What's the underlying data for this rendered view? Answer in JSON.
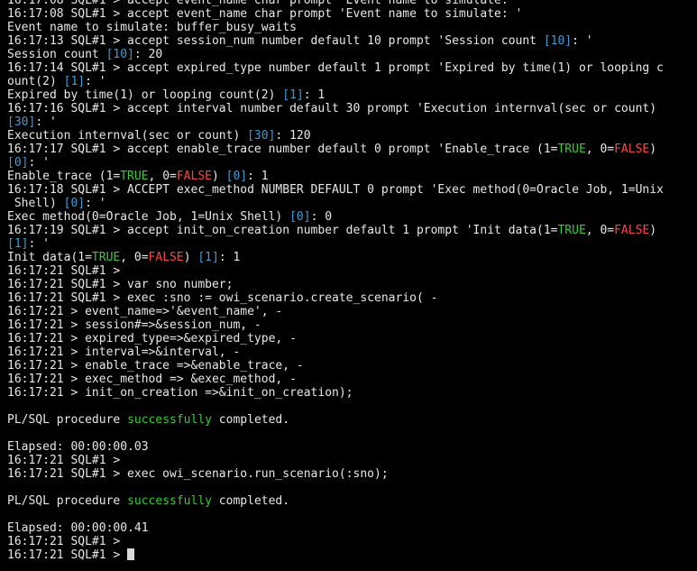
{
  "colors": {
    "background": "#000000",
    "text": "#e8e8e8",
    "true_highlight": "#33cc33",
    "false_highlight": "#ff4444",
    "default_highlight": "#3a9fd6"
  },
  "terminal": {
    "lines": [
      [
        {
          "t": "16:17:08 SQL#1 > accept event_name char prompt 'Event name to simulate: '"
        }
      ],
      [
        {
          "t": "16:17:08 SQL#1 > accept event_name char prompt 'Event name to simulate: '"
        }
      ],
      [
        {
          "t": "Event name to simulate: buffer_busy_waits"
        }
      ],
      [
        {
          "t": "16:17:13 SQL#1 > accept session_num number default 10 prompt 'Session count "
        },
        {
          "t": "[10]",
          "c": "blue"
        },
        {
          "t": ": '"
        }
      ],
      [
        {
          "t": "Session count "
        },
        {
          "t": "[10]",
          "c": "blue"
        },
        {
          "t": ": 20"
        }
      ],
      [
        {
          "t": "16:17:14 SQL#1 > accept expired_type number default 1 prompt 'Expired by time(1) or looping c"
        }
      ],
      [
        {
          "t": "ount(2) "
        },
        {
          "t": "[1]",
          "c": "blue"
        },
        {
          "t": ": '"
        }
      ],
      [
        {
          "t": "Expired by time(1) or looping count(2) "
        },
        {
          "t": "[1]",
          "c": "blue"
        },
        {
          "t": ": 1"
        }
      ],
      [
        {
          "t": "16:17:16 SQL#1 > accept interval number default 30 prompt 'Execution internval(sec or count)"
        }
      ],
      [
        {
          "t": "[30]",
          "c": "blue"
        },
        {
          "t": ": '"
        }
      ],
      [
        {
          "t": "Execution internval(sec or count) "
        },
        {
          "t": "[30]",
          "c": "blue"
        },
        {
          "t": ": 120"
        }
      ],
      [
        {
          "t": "16:17:17 SQL#1 > accept enable_trace number default 0 prompt 'Enable_trace (1="
        },
        {
          "t": "TRUE",
          "c": "green"
        },
        {
          "t": ", 0="
        },
        {
          "t": "FALSE",
          "c": "red"
        },
        {
          "t": ")"
        }
      ],
      [
        {
          "t": "[0]",
          "c": "blue"
        },
        {
          "t": ": '"
        }
      ],
      [
        {
          "t": "Enable_trace (1="
        },
        {
          "t": "TRUE",
          "c": "green"
        },
        {
          "t": ", 0="
        },
        {
          "t": "FALSE",
          "c": "red"
        },
        {
          "t": ") "
        },
        {
          "t": "[0]",
          "c": "blue"
        },
        {
          "t": ": 1"
        }
      ],
      [
        {
          "t": "16:17:18 SQL#1 > ACCEPT exec_method NUMBER DEFAULT 0 prompt 'Exec method(0=Oracle Job, 1=Unix"
        }
      ],
      [
        {
          "t": " Shell) "
        },
        {
          "t": "[0]",
          "c": "blue"
        },
        {
          "t": ": '"
        }
      ],
      [
        {
          "t": "Exec method(0=Oracle Job, 1=Unix Shell) "
        },
        {
          "t": "[0]",
          "c": "blue"
        },
        {
          "t": ": 0"
        }
      ],
      [
        {
          "t": "16:17:19 SQL#1 > accept init_on_creation number default 1 prompt 'Init data(1="
        },
        {
          "t": "TRUE",
          "c": "green"
        },
        {
          "t": ", 0="
        },
        {
          "t": "FALSE",
          "c": "red"
        },
        {
          "t": ")"
        }
      ],
      [
        {
          "t": "[1]",
          "c": "blue"
        },
        {
          "t": ": '"
        }
      ],
      [
        {
          "t": "Init data(1="
        },
        {
          "t": "TRUE",
          "c": "green"
        },
        {
          "t": ", 0="
        },
        {
          "t": "FALSE",
          "c": "red"
        },
        {
          "t": ") "
        },
        {
          "t": "[1]",
          "c": "blue"
        },
        {
          "t": ": 1"
        }
      ],
      [
        {
          "t": "16:17:21 SQL#1 >"
        }
      ],
      [
        {
          "t": "16:17:21 SQL#1 > var sno number;"
        }
      ],
      [
        {
          "t": "16:17:21 SQL#1 > exec :sno := owi_scenario.create_scenario( -"
        }
      ],
      [
        {
          "t": "16:17:21 > event_name=>'&event_name', -"
        }
      ],
      [
        {
          "t": "16:17:21 > session#=>&session_num, -"
        }
      ],
      [
        {
          "t": "16:17:21 > expired_type=>&expired_type, -"
        }
      ],
      [
        {
          "t": "16:17:21 > interval=>&interval, -"
        }
      ],
      [
        {
          "t": "16:17:21 > enable_trace =>&enable_trace, -"
        }
      ],
      [
        {
          "t": "16:17:21 > exec_method => &exec_method, -"
        }
      ],
      [
        {
          "t": "16:17:21 > init_on_creation =>&init_on_creation);"
        }
      ],
      [
        {
          "t": ""
        }
      ],
      [
        {
          "t": "PL/SQL procedure "
        },
        {
          "t": "successfully",
          "c": "green"
        },
        {
          "t": " completed."
        }
      ],
      [
        {
          "t": ""
        }
      ],
      [
        {
          "t": "Elapsed: 00:00:00.03"
        }
      ],
      [
        {
          "t": "16:17:21 SQL#1 >"
        }
      ],
      [
        {
          "t": "16:17:21 SQL#1 > exec owi_scenario.run_scenario(:sno);"
        }
      ],
      [
        {
          "t": ""
        }
      ],
      [
        {
          "t": "PL/SQL procedure "
        },
        {
          "t": "successfully",
          "c": "green"
        },
        {
          "t": " completed."
        }
      ],
      [
        {
          "t": ""
        }
      ],
      [
        {
          "t": "Elapsed: 00:00:00.41"
        }
      ],
      [
        {
          "t": "16:17:21 SQL#1 >"
        }
      ],
      [
        {
          "t": "16:17:21 SQL#1 > "
        }
      ]
    ]
  },
  "status_bar": {
    "text": "   ... ... ... ... .... ... ... .. ... ... ... ... .... ... ... ...."
  }
}
